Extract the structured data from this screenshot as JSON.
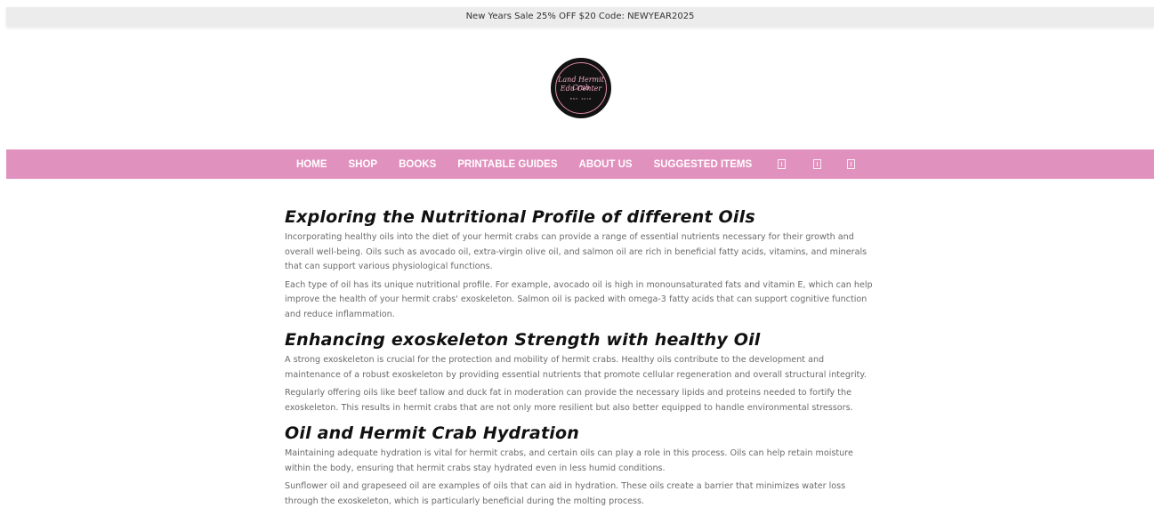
{
  "announcement": {
    "text": "New Years Sale 25% OFF $20 Code: NEWYEAR2025"
  },
  "logo": {
    "line1": "Land Hermit Crab",
    "line2": "Edu Center",
    "line3": "EST. 2018"
  },
  "nav": {
    "items": [
      {
        "label": "HOME"
      },
      {
        "label": "SHOP"
      },
      {
        "label": "BOOKS"
      },
      {
        "label": "PRINTABLE GUIDES"
      },
      {
        "label": "ABOUT US"
      },
      {
        "label": "SUGGESTED ITEMS"
      }
    ],
    "icons": [
      "search-icon",
      "account-icon",
      "cart-icon"
    ]
  },
  "colors": {
    "nav_bg": "#e191bd",
    "announcement_bg": "#ececec",
    "heading": "#111111",
    "body_text": "#6b6b6b"
  },
  "article": {
    "sections": [
      {
        "title": "Exploring the Nutritional Profile of different Oils",
        "paragraphs": [
          "Incorporating healthy oils into the diet of your hermit crabs can provide a range of essential nutrients necessary for their growth and overall well-being. Oils such as avocado oil, extra-virgin olive oil, and salmon oil are rich in beneficial fatty acids, vitamins, and minerals that can support various physiological functions.",
          "Each type of oil has its unique nutritional profile. For example, avocado oil is high in monounsaturated fats and vitamin E, which can help improve the health of your hermit crabs' exoskeleton. Salmon oil is packed with omega-3 fatty acids that can support cognitive function and reduce inflammation."
        ]
      },
      {
        "title": "Enhancing exoskeleton Strength with healthy Oil",
        "paragraphs": [
          "A strong exoskeleton is crucial for the protection and mobility of hermit crabs. Healthy oils contribute to the development and maintenance of a robust exoskeleton by providing essential nutrients that promote cellular regeneration and overall structural integrity.",
          "Regularly offering oils like beef tallow and duck fat in moderation can provide the necessary lipids and proteins needed to fortify the exoskeleton. This results in hermit crabs that are not only more resilient but also better equipped to handle environmental stressors."
        ]
      },
      {
        "title": "Oil and Hermit Crab Hydration",
        "paragraphs": [
          "Maintaining adequate hydration is vital for hermit crabs, and certain oils can play a role in this process. Oils can help retain moisture within the body, ensuring that hermit crabs stay hydrated even in less humid conditions.",
          "Sunflower oil and grapeseed oil are examples of oils that can aid in hydration. These oils create a barrier that minimizes water loss through the exoskeleton, which is particularly beneficial during the molting process."
        ]
      }
    ]
  }
}
